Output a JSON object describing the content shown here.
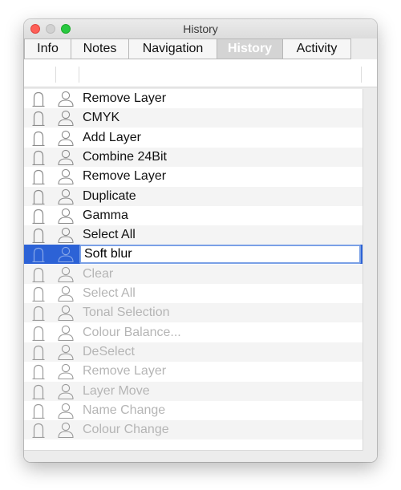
{
  "window": {
    "title": "History"
  },
  "tabs": [
    {
      "label": "Info",
      "active": false
    },
    {
      "label": "Notes",
      "active": false
    },
    {
      "label": "Navigation",
      "active": false
    },
    {
      "label": "History",
      "active": true
    },
    {
      "label": "Activity",
      "active": false
    }
  ],
  "history": {
    "items": [
      {
        "label": "Remove Layer",
        "state": "active"
      },
      {
        "label": "CMYK",
        "state": "active"
      },
      {
        "label": "Add Layer",
        "state": "active"
      },
      {
        "label": "Combine 24Bit",
        "state": "active"
      },
      {
        "label": "Remove Layer",
        "state": "active"
      },
      {
        "label": "Duplicate",
        "state": "active"
      },
      {
        "label": "Gamma",
        "state": "active"
      },
      {
        "label": "Select All",
        "state": "active"
      },
      {
        "label": "Soft blur",
        "state": "selected-editing"
      },
      {
        "label": "Clear",
        "state": "undone"
      },
      {
        "label": "Select All",
        "state": "undone"
      },
      {
        "label": "Tonal Selection",
        "state": "undone"
      },
      {
        "label": "Colour Balance...",
        "state": "undone"
      },
      {
        "label": "DeSelect",
        "state": "undone"
      },
      {
        "label": "Remove Layer",
        "state": "undone"
      },
      {
        "label": "Layer Move",
        "state": "undone"
      },
      {
        "label": "Name Change",
        "state": "undone"
      },
      {
        "label": "Colour Change",
        "state": "undone"
      }
    ]
  },
  "colors": {
    "selection": "#2c62d6",
    "edit_border": "#7aa0e6",
    "disabled_text": "#b5b5b5",
    "active_tab_bg": "#d4d4d4"
  },
  "icons": {
    "lock": "lock-icon",
    "person": "person-icon"
  }
}
